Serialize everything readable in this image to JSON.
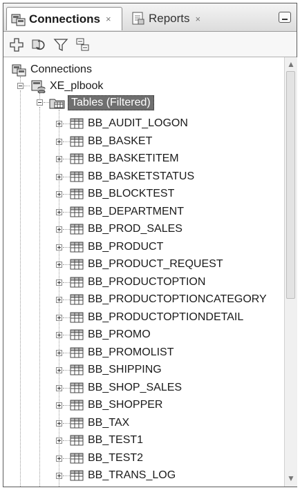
{
  "tabs": [
    {
      "label": "Connections",
      "close": "×",
      "active": true,
      "icon": "connections-icon"
    },
    {
      "label": "Reports",
      "close": "×",
      "active": false,
      "icon": "reports-icon"
    }
  ],
  "toolbar": {
    "buttons": [
      {
        "name": "add-connection-button",
        "icon": "plus-icon"
      },
      {
        "name": "refresh-button",
        "icon": "refresh-icon"
      },
      {
        "name": "filter-button",
        "icon": "filter-icon"
      },
      {
        "name": "collapse-button",
        "icon": "collapse-all-icon"
      }
    ]
  },
  "tree": {
    "root_label": "Connections",
    "connection_label": "XE_plbook",
    "tables_label": "Tables (Filtered)",
    "tables": [
      "BB_AUDIT_LOGON",
      "BB_BASKET",
      "BB_BASKETITEM",
      "BB_BASKETSTATUS",
      "BB_BLOCKTEST",
      "BB_DEPARTMENT",
      "BB_PROD_SALES",
      "BB_PRODUCT",
      "BB_PRODUCT_REQUEST",
      "BB_PRODUCTOPTION",
      "BB_PRODUCTOPTIONCATEGORY",
      "BB_PRODUCTOPTIONDETAIL",
      "BB_PROMO",
      "BB_PROMOLIST",
      "BB_SHIPPING",
      "BB_SHOP_SALES",
      "BB_SHOPPER",
      "BB_TAX",
      "BB_TEST1",
      "BB_TEST2",
      "BB_TRANS_LOG"
    ]
  },
  "colors": {
    "selection": "#6f6f6f",
    "table_grid": "#555555"
  }
}
